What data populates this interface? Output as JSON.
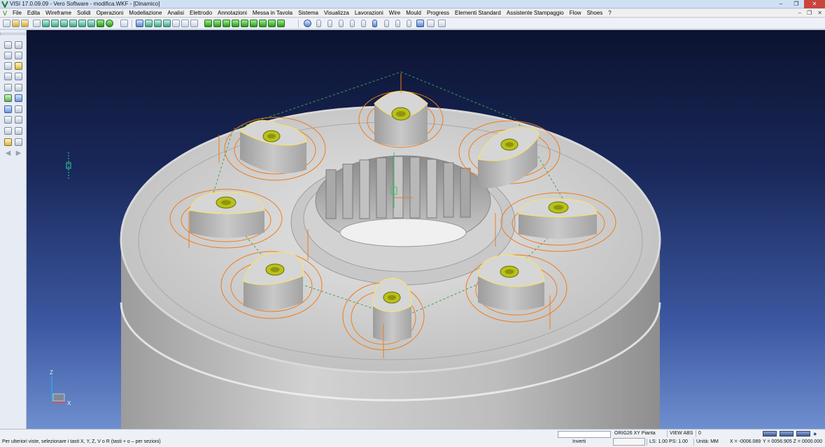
{
  "window": {
    "title": "VISI 17.0.09.09 - Vero Software - modifica.WKF - [Dinamico]",
    "minimize_glyph": "–",
    "maximize_glyph": "❐",
    "close_glyph": "✕"
  },
  "menu": {
    "logo_glyph": "V",
    "items": [
      "File",
      "Edita",
      "Wireframe",
      "Solidi",
      "Operazioni",
      "Modellazione",
      "Analisi",
      "Elettrodo",
      "Annotazioni",
      "Messa in Tavola",
      "Sistema",
      "Visualizza",
      "Lavorazioni",
      "Wire",
      "Mould",
      "Progress",
      "Elementi Standard",
      "Assistente Stampaggio",
      "Flow",
      "Shoes",
      "?"
    ],
    "doc_controls": [
      "–",
      "❐",
      "✕"
    ]
  },
  "toolbar": {
    "buttons": [
      "new-icon",
      "open-icon",
      "open-folder-icon",
      "save-icon",
      "save-as-icon",
      "print-icon",
      "import-icon",
      "export-icon",
      "undo-icon",
      "redo-icon",
      "select-icon",
      "move-icon",
      "rotate-icon",
      "pan-icon",
      "render-icon",
      "wireframe-cube-icon",
      "shaded-cube-icon",
      "hidden-cube-icon",
      "green-cube-icon",
      "edge-cube-icon",
      "view-cube-icon",
      "iso-cube-icon",
      "refresh-icon",
      "layer-icon",
      "cylinder-icon",
      "cylinder-shaded-icon",
      "cylinder-edges-icon",
      "cylinder-hidden-icon",
      "section-icon",
      "cylinder-view-icon",
      "cylinder-iso-icon",
      "part-icon",
      "grid-icon"
    ]
  },
  "left_palette": {
    "tools": [
      "point-icon",
      "line-icon",
      "circle-icon",
      "arc-icon",
      "rectangle-icon",
      "spline-icon",
      "offset-icon",
      "trim-icon",
      "extrude-icon",
      "revolve-icon",
      "boolean-icon",
      "fillet-icon",
      "chamfer-icon",
      "shell-icon",
      "hole-icon",
      "cut-icon",
      "dimension-icon",
      "text-icon",
      "measure-icon",
      "layer-icon",
      "back-arrow-icon",
      "forward-arrow-icon"
    ]
  },
  "viewport": {
    "axis_triad": {
      "z_label": "Z",
      "x_label": "X"
    },
    "model": "flange with tapped pockets and internal spline",
    "colors": {
      "part": "#c4c4c4",
      "toolpath": "#f07c1a",
      "thread": "#b8c218",
      "edge_highlight": "#ffe45a"
    }
  },
  "statusbar": {
    "hint": "Per ulteriori viste, selezionare i tasti X, Y, Z, V o R (tasti  + o – per sezioni)",
    "search_value": "",
    "origin_label": "ORIG26 XY Pianta",
    "view_label": "VIEW ABS",
    "view_value": "0",
    "inverti_label": "Inverti",
    "ls_ps": "LS: 1.00 PS: 1.00",
    "units": "Unità: MM",
    "coord_x": "X = -0006.089",
    "coord_yz": "Y = 0056.905 Z = 0000.000"
  }
}
